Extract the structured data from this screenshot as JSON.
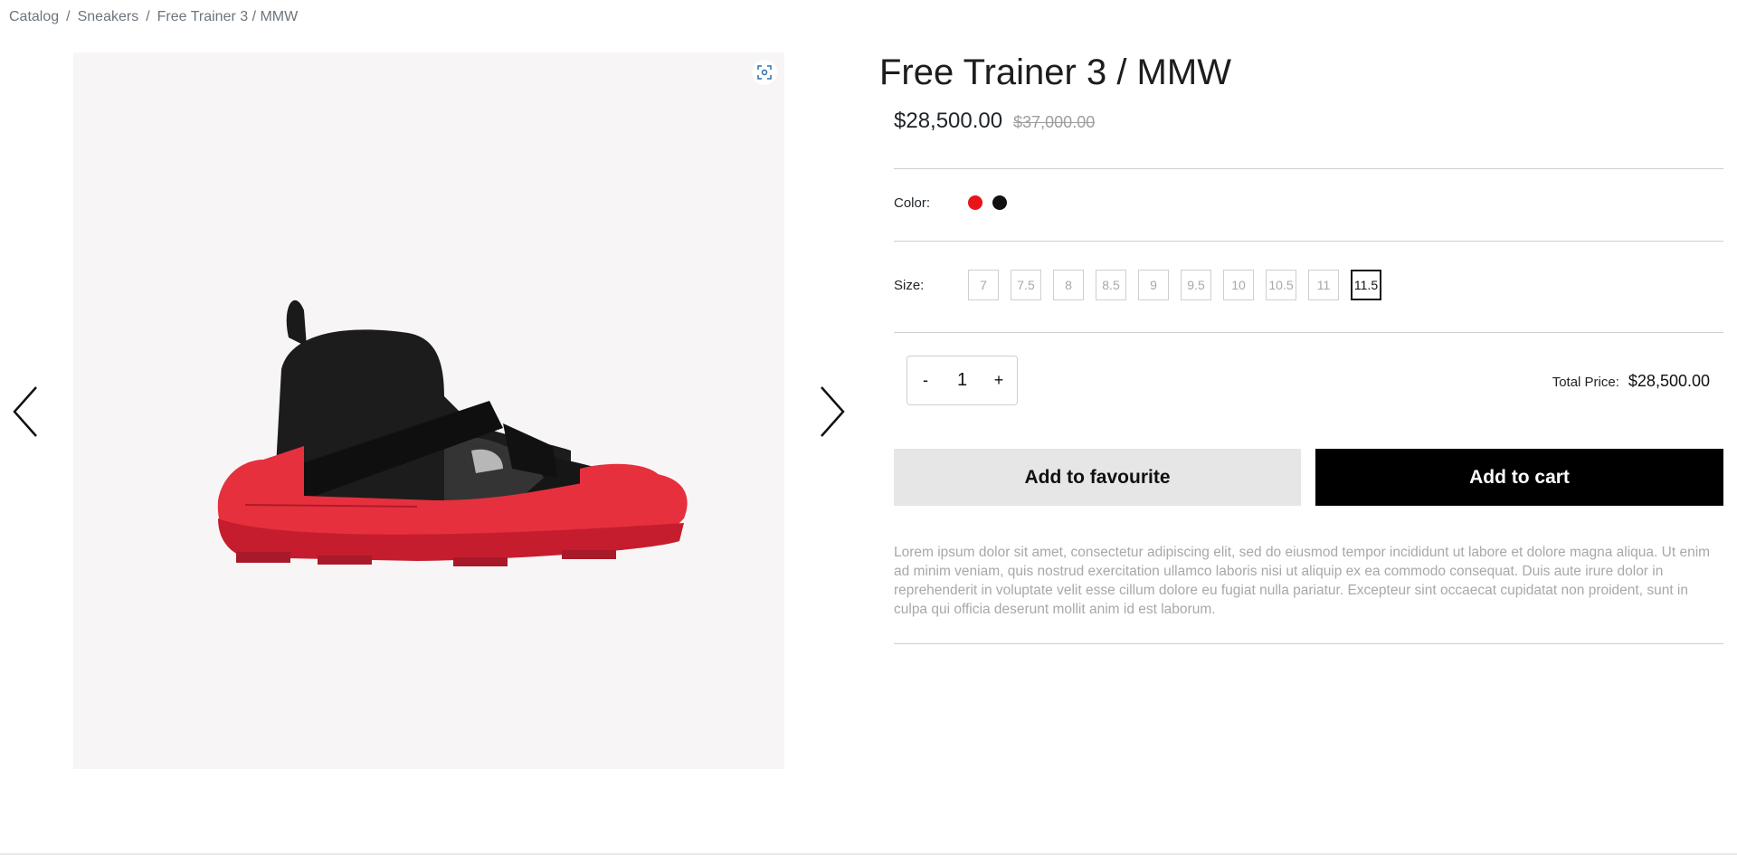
{
  "breadcrumb": {
    "items": [
      "Catalog",
      "Sneakers",
      "Free Trainer 3 / MMW"
    ],
    "separator": "/"
  },
  "product": {
    "title": "Free Trainer 3 / MMW",
    "price": "$28,500.00",
    "old_price": "$37,000.00",
    "colors": {
      "label": "Color:",
      "options": [
        {
          "name": "red",
          "hex": "#e8141b"
        },
        {
          "name": "black",
          "hex": "#111111"
        }
      ]
    },
    "sizes": {
      "label": "Size:",
      "options": [
        "7",
        "7.5",
        "8",
        "8.5",
        "9",
        "9.5",
        "10",
        "10.5",
        "11",
        "11.5"
      ],
      "selected": "11.5"
    },
    "quantity": {
      "decrement": "-",
      "value": "1",
      "increment": "+"
    },
    "total": {
      "label": "Total Price:",
      "value": "$28,500.00"
    },
    "actions": {
      "favourite": "Add to favourite",
      "cart": "Add to cart"
    },
    "description": "Lorem ipsum dolor sit amet, consectetur adipiscing elit, sed do eiusmod tempor incididunt ut labore et dolore magna aliqua. Ut enim ad minim veniam, quis nostrud exercitation ullamco laboris nisi ut aliquip ex ea commodo consequat. Duis aute irure dolor in reprehenderit in voluptate velit esse cillum dolore eu fugiat nulla pariatur. Excepteur sint occaecat cupidatat non proident, sunt in culpa qui officia deserunt mollit anim id est laborum."
  },
  "gallery": {
    "icons": {
      "zoom": "fullscreen-focus-icon",
      "prev": "chevron-left-icon",
      "next": "chevron-right-icon"
    }
  },
  "colors": {
    "accent_dark": "#000000",
    "button_light": "#e6e6e6",
    "muted_text": "#a8a8a8"
  }
}
